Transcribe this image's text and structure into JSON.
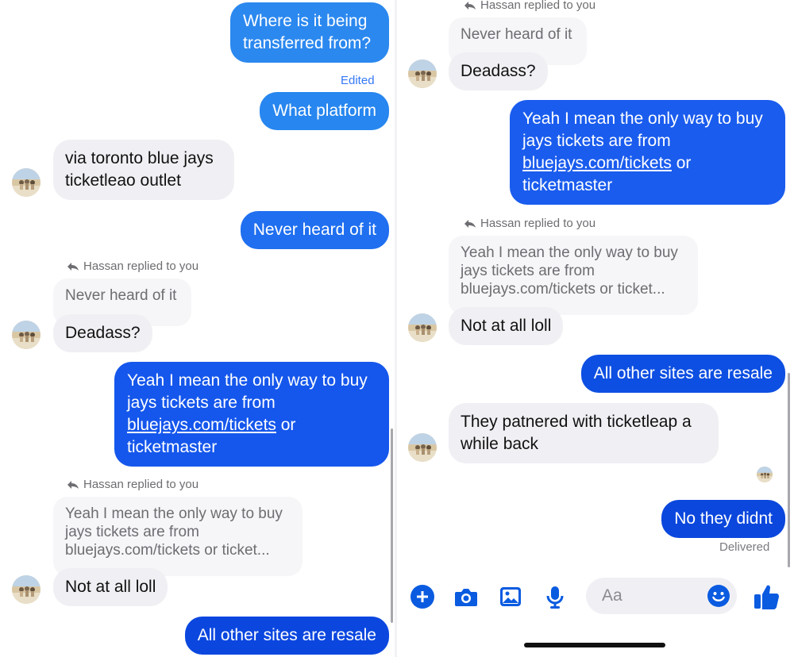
{
  "colors": {
    "outgoing_top": "#2b8aee",
    "outgoing_bottom": "#0a43d8",
    "incoming": "#f0f0f4",
    "accent": "#0a5be0"
  },
  "left": {
    "out_transfer": "Where is it being transferred from?",
    "edited_label": "Edited",
    "out_platform": "What platform",
    "in_via": "via toronto blue jays ticketleao outlet",
    "out_never": "Never heard of it",
    "reply1_label": "Hassan replied to you",
    "reply1_quote": "Never heard of it",
    "in_deadass": "Deadass?",
    "out_yeah_a": "Yeah I mean the only way to buy jays tickets are from",
    "out_yeah_link": "bluejays.com/tickets",
    "out_yeah_b": " or ticketmaster",
    "reply2_label": "Hassan replied to you",
    "reply2_quote": "Yeah I mean the only way to buy jays tickets are from bluejays.com/tickets or ticket...",
    "in_notatall": "Not at all loll",
    "out_resale": "All other sites are resale"
  },
  "right": {
    "reply1_label": "Hassan replied to you",
    "reply1_quote": "Never heard of it",
    "in_deadass": "Deadass?",
    "out_yeah_a": "Yeah I mean the only way to buy jays tickets are from",
    "out_yeah_link": "bluejays.com/tickets",
    "out_yeah_b": " or ticketmaster",
    "reply2_label": "Hassan replied to you",
    "reply2_quote": "Yeah I mean the only way to buy jays tickets are from bluejays.com/tickets or ticket...",
    "in_notatall": "Not at all loll",
    "out_resale": "All other sites are resale",
    "in_partnered": "They patnered with ticketleap a while back",
    "out_didnt": "No they didnt",
    "status": "Delivered"
  },
  "composer": {
    "placeholder": "Aa",
    "icons": [
      "plus-icon",
      "camera-icon",
      "gallery-icon",
      "microphone-icon",
      "emoji-icon",
      "thumbs-up-icon"
    ]
  }
}
